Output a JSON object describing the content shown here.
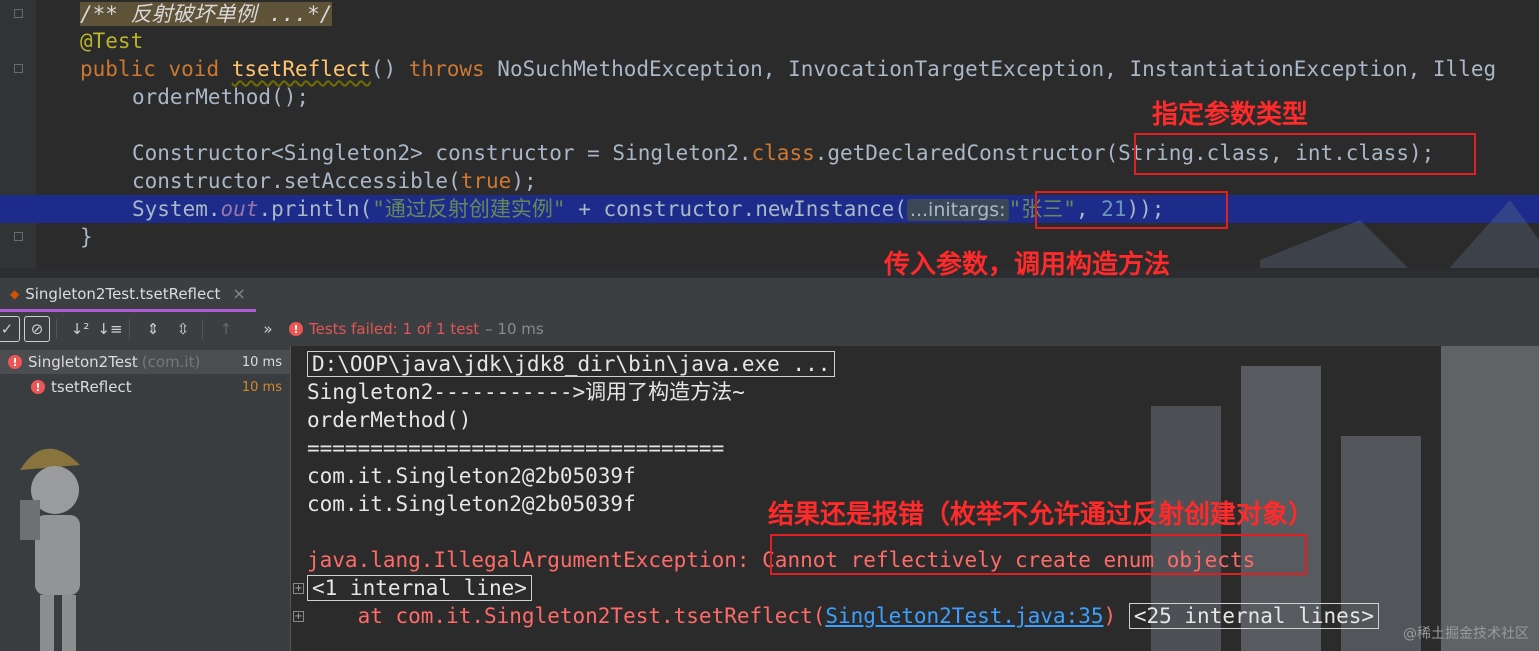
{
  "editor": {
    "comment": "/** 反射破坏单例 ...*/",
    "annotation": "@Test",
    "kw_public": "public",
    "kw_void": "void",
    "method_name": "tsetReflect",
    "paren": "()",
    "kw_throws": "throws",
    "exceptions": "NoSuchMethodException, InvocationTargetException, InstantiationException, Illeg",
    "line_order": "orderMethod();",
    "line_ctor_prefix": "Constructor<Singleton2> constructor = Singleton2.",
    "kw_class": "class",
    "line_ctor_mid": ".getDeclaredConstructor",
    "line_ctor_args": "(String.class, int.class);",
    "line_access_prefix": "constructor.setAccessible(",
    "kw_true": "true",
    "line_access_suffix": ");",
    "line_print_prefix": "System.",
    "field_out": "out",
    "line_print_mid": ".println(",
    "str_create": "\"通过反射创建实例\"",
    "line_print_mid2": " + constructor.newInstance(",
    "param_hint": "...initargs:",
    "str_name": "\"张三\"",
    "comma": ", ",
    "num_21": "21",
    "line_print_end": "));",
    "closing_brace": "}"
  },
  "annotations": {
    "specify_param_types": "指定参数类型",
    "pass_params": "传入参数，调用构造方法",
    "result_error": "结果还是报错（枚举不允许通过反射创建对象）"
  },
  "run_window": {
    "tab_label": "Singleton2Test.tsetReflect",
    "status_text": "Tests failed: 1 of 1 test",
    "status_time": "– 10 ms",
    "tree": [
      {
        "name": "Singleton2Test",
        "pkg": "(com.it)",
        "time": "10 ms"
      },
      {
        "name": "tsetReflect",
        "pkg": "",
        "time": "10 ms"
      }
    ]
  },
  "console": {
    "lines": [
      "D:\\OOP\\java\\jdk\\jdk8_dir\\bin\\java.exe ...",
      "Singleton2----------->调用了构造方法~",
      "orderMethod()",
      "=================================",
      "com.it.Singleton2@2b05039f",
      "com.it.Singleton2@2b05039f"
    ],
    "exception_prefix": "java.lang.IllegalArgumentException: ",
    "exception_message": "Cannot reflectively create enum objects",
    "internal_line": "<1 internal line>",
    "at_prefix": "    at com.it.Singleton2Test.tsetReflect(",
    "at_link": "Singleton2Test.java:35",
    "at_suffix": ")",
    "internal_lines": "<25 internal lines>"
  },
  "watermark": "@稀土掘金技术社区",
  "colors": {
    "accent_red": "#e02020",
    "run_tab_purple": "#b05cd6",
    "error_text": "#ff6b68",
    "link": "#3da0ff"
  }
}
